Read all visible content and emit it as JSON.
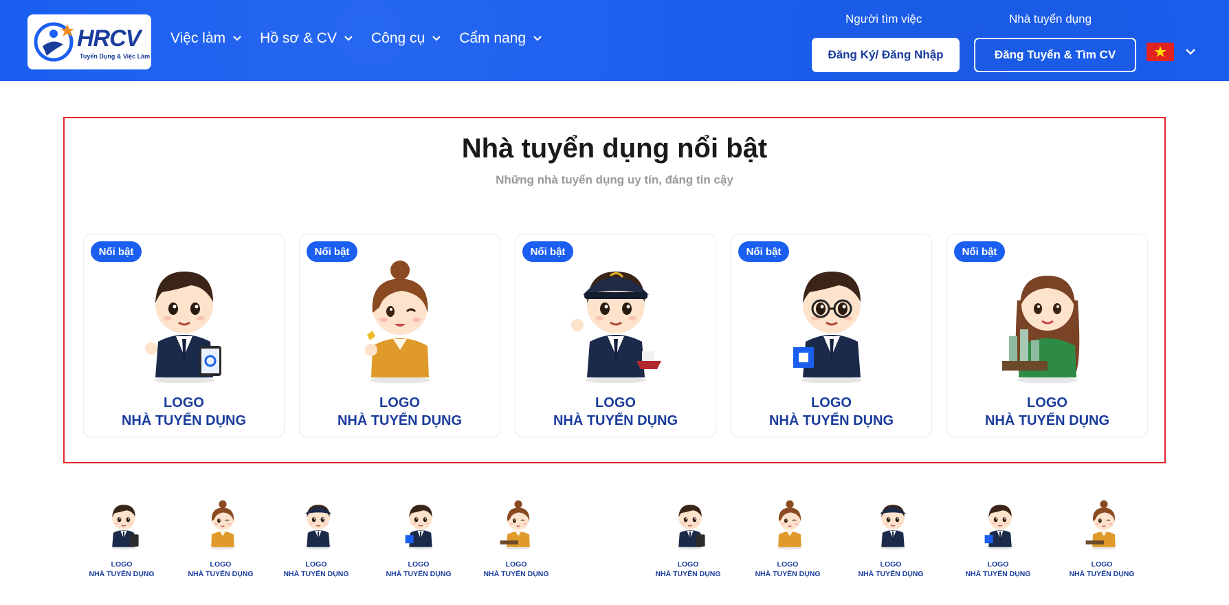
{
  "header": {
    "logo": {
      "text": "HRCV",
      "tagline": "Tuyển Dụng & Việc Làm"
    },
    "nav": [
      {
        "label": "Việc làm",
        "icon": "chevron-down-icon"
      },
      {
        "label": "Hồ sơ & CV",
        "icon": "chevron-down-icon"
      },
      {
        "label": "Công cụ",
        "icon": "chevron-down-icon"
      },
      {
        "label": "Cẩm nang",
        "icon": "chevron-down-icon"
      }
    ],
    "job_seeker": {
      "label": "Người tìm việc",
      "button": "Đăng Ký/ Đăng Nhập"
    },
    "employer": {
      "label": "Nhà tuyển dụng",
      "button": "Đăng Tuyển & Tìm CV"
    },
    "language": {
      "flag": "vietnam-flag-icon"
    },
    "colors": {
      "primary": "#1b5ff0",
      "brand_dark": "#1a3c9c",
      "highlight_border": "#e2232b"
    }
  },
  "featured": {
    "title": "Nhà tuyển dụng nổi bật",
    "subtitle": "Những nhà tuyển dụng uy tín, đáng tin cậy",
    "cards": [
      {
        "badge": "Nổi bật",
        "logo_line1": "LOGO",
        "logo_line2": "NHÀ TUYỂN DỤNG",
        "character": "businessman-tablet"
      },
      {
        "badge": "Nổi bật",
        "logo_line1": "LOGO",
        "logo_line2": "NHÀ TUYỂN DỤNG",
        "character": "businesswoman-bun"
      },
      {
        "badge": "Nổi bật",
        "logo_line1": "LOGO",
        "logo_line2": "NHÀ TUYỂN DỤNG",
        "character": "ship-captain"
      },
      {
        "badge": "Nổi bật",
        "logo_line1": "LOGO",
        "logo_line2": "NHÀ TUYỂN DỤNG",
        "character": "man-glasses-box"
      },
      {
        "badge": "Nổi bật",
        "logo_line1": "LOGO",
        "logo_line2": "NHÀ TUYỂN DỤNG",
        "character": "woman-building-model"
      }
    ]
  },
  "mini_logos": [
    {
      "line1": "LOGO",
      "line2": "NHÀ TUYỂN DỤNG"
    },
    {
      "line1": "LOGO",
      "line2": "NHÀ TUYỂN DỤNG"
    },
    {
      "line1": "LOGO",
      "line2": "NHÀ TUYỂN DỤNG"
    },
    {
      "line1": "LOGO",
      "line2": "NHÀ TUYỂN DỤNG"
    },
    {
      "line1": "LOGO",
      "line2": "NHÀ TUYỂN DỤNG"
    },
    {
      "line1": "LOGO",
      "line2": "NHÀ TUYỂN DỤNG"
    },
    {
      "line1": "LOGO",
      "line2": "NHÀ TUYỂN DỤNG"
    },
    {
      "line1": "LOGO",
      "line2": "NHÀ TUYỂN DỤNG"
    },
    {
      "line1": "LOGO",
      "line2": "NHÀ TUYỂN DỤNG"
    },
    {
      "line1": "LOGO",
      "line2": "NHÀ TUYỂN DỤNG"
    }
  ]
}
